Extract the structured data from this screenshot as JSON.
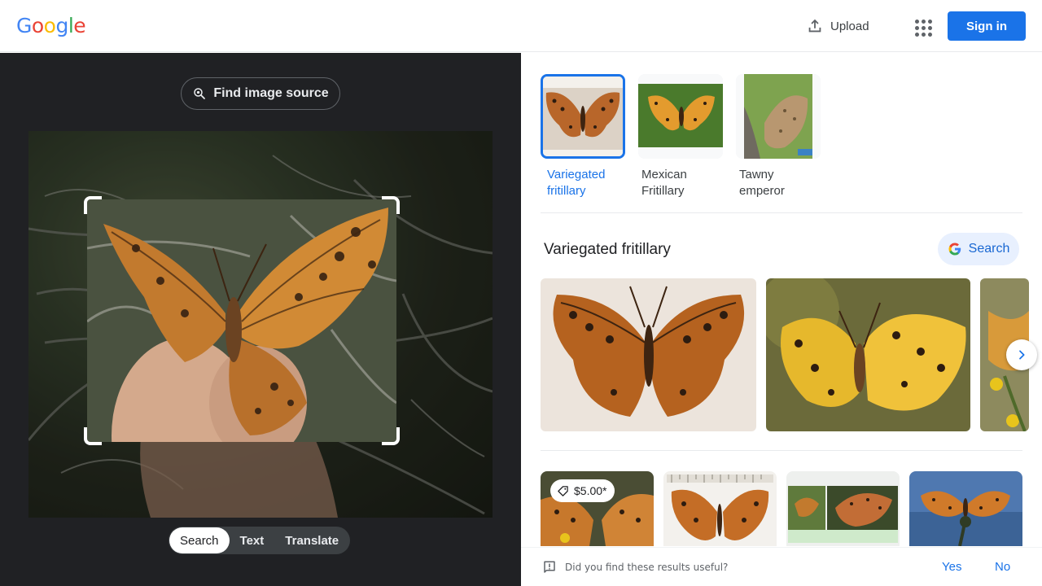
{
  "header": {
    "logo_letters": [
      "G",
      "o",
      "o",
      "g",
      "l",
      "e"
    ],
    "upload_label": "Upload",
    "signin_label": "Sign in"
  },
  "lens": {
    "find_source_label": "Find image source",
    "modes": [
      {
        "label": "Search",
        "active": true
      },
      {
        "label": "Text",
        "active": false
      },
      {
        "label": "Translate",
        "active": false
      }
    ]
  },
  "matches": [
    {
      "name": "Variegated fritillary",
      "selected": true
    },
    {
      "name": "Mexican Fritillary",
      "selected": false
    },
    {
      "name": "Tawny emperor",
      "selected": false
    }
  ],
  "section": {
    "title": "Variegated fritillary",
    "search_label": "Search"
  },
  "results": {
    "price": "$5.00*"
  },
  "feedback": {
    "question": "Did you find these results useful?",
    "yes": "Yes",
    "no": "No"
  },
  "colors": {
    "accent": "#1a73e8",
    "dark_pane": "#202124"
  }
}
